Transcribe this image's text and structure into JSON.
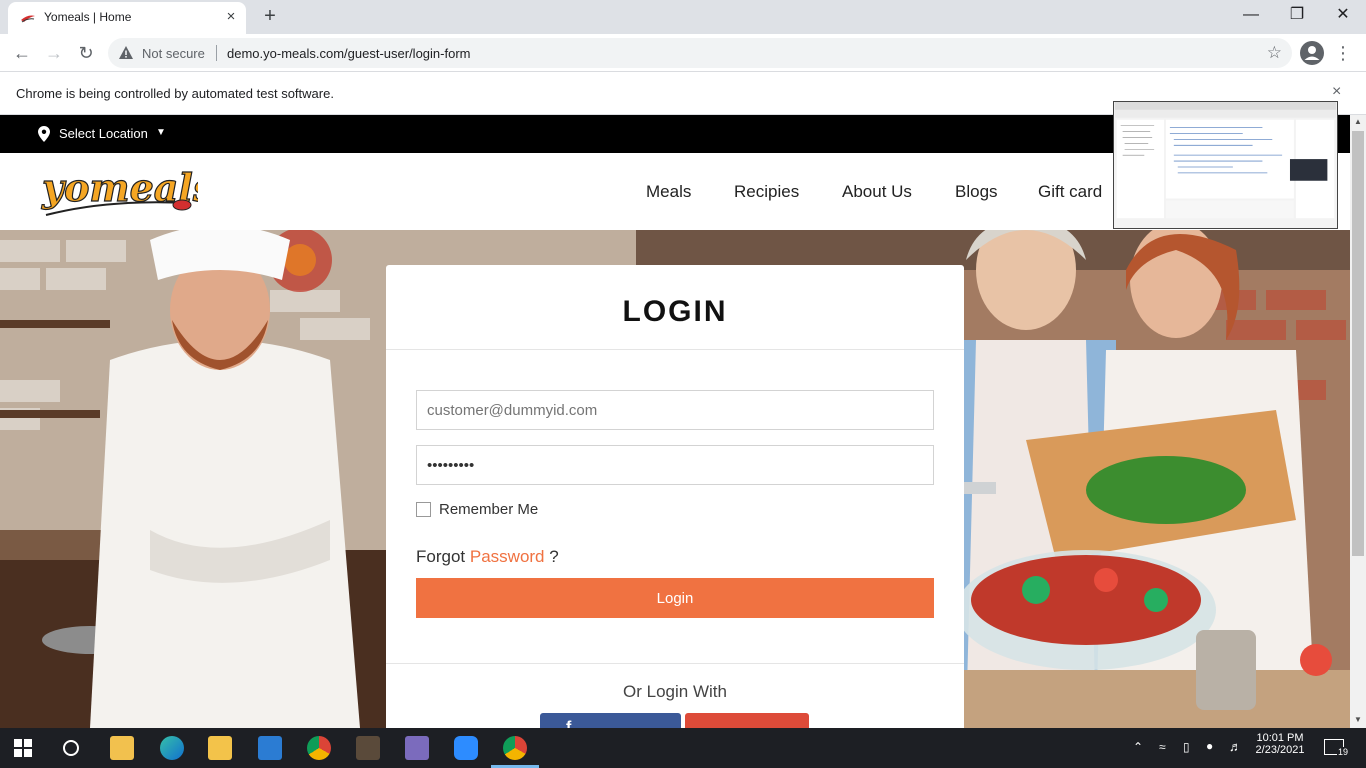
{
  "browser": {
    "tab_title": "Yomeals | Home",
    "tab_close": "×",
    "new_tab": "+",
    "security_label": "Not secure",
    "url": "demo.yo-meals.com/guest-user/login-form",
    "infobar_text": "Chrome is being controlled by automated test software.",
    "infobar_close": "×"
  },
  "topbar": {
    "location_label": "Select Location"
  },
  "header": {
    "logo_text": "yomeals",
    "nav": [
      "Meals",
      "Recipies",
      "About Us",
      "Blogs",
      "Gift card"
    ]
  },
  "login": {
    "title": "LOGIN",
    "email_placeholder": "customer@dummyid.com",
    "password_value": "•••••••••",
    "remember_label": "Remember Me",
    "forgot_prefix": "Forgot",
    "forgot_link": "Password",
    "forgot_suffix": "?",
    "login_button": "Login",
    "or_login_with": "Or Login With"
  },
  "taskbar": {
    "time": "10:01 PM",
    "date": "2/23/2021",
    "notification_count": "19"
  },
  "colors": {
    "accent": "#f07241",
    "facebook": "#3b5998",
    "google": "#dd4b39"
  }
}
